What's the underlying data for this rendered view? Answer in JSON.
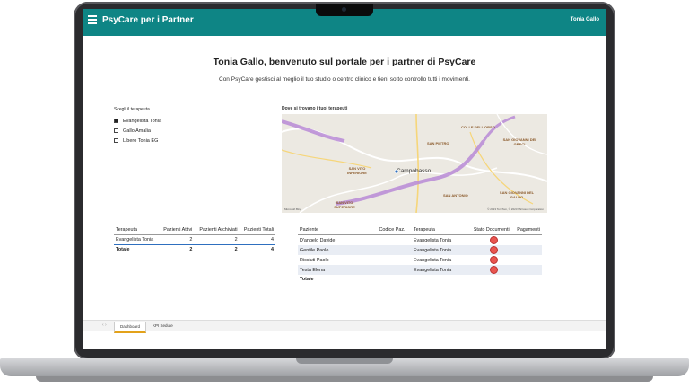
{
  "app": {
    "title": "PsyCare per i Partner",
    "user": "Tonia Gallo"
  },
  "welcome": {
    "heading": "Tonia Gallo, benvenuto sul portale per i partner di PsyCare",
    "subtitle": "Con PsyCare gestisci al meglio il tuo studio o centro clinico e tieni sotto controllo tutti i movimenti."
  },
  "slicer": {
    "title": "Scegli il terapeuta",
    "items": [
      {
        "label": "Evangelista Tonia",
        "checked": true
      },
      {
        "label": "Gallo Amalia",
        "checked": false
      },
      {
        "label": "Libero Tonia EG",
        "checked": false
      }
    ]
  },
  "map": {
    "title": "Dove si trovano i tuoi terapeuti",
    "city": "Campobasso",
    "labels": [
      "COLLE DELL'ORSO",
      "SAN PIETRO",
      "SAN GIOVANNI DEI GRECI",
      "SAN VITO INFERIORE",
      "SAN VITO SUPERIORE",
      "SAN GIOVANNI DEL GALDO",
      "SAN ANTONIO"
    ],
    "attribution": "© 2023 TomTom, © 2023 Microsoft Corporation",
    "logo": "Microsoft Bing"
  },
  "summary_table": {
    "headers": [
      "Terapeuta",
      "Pazienti Attivi",
      "Pazienti Archiviati",
      "Pazienti Totali"
    ],
    "rows": [
      [
        "Evangelista Tonia",
        "2",
        "2",
        "4"
      ]
    ],
    "total": [
      "Totale",
      "2",
      "2",
      "4"
    ]
  },
  "patients_table": {
    "headers": [
      "Paziente",
      "Codice Paz.",
      "Terapeuta",
      "Stato Documenti",
      "Pagamenti"
    ],
    "rows": [
      [
        "D'angelo Davide",
        "",
        "Evangelista Tonia"
      ],
      [
        "Gentile Paolo",
        "",
        "Evangelista Tonia"
      ],
      [
        "Ricciuti Paolo",
        "",
        "Evangelista Tonia"
      ],
      [
        "Testa Elena",
        "",
        "Evangelista Tonia"
      ]
    ],
    "total": "Totale",
    "status_color": "#e8554f"
  },
  "tabs": [
    {
      "label": "Dashboard",
      "active": true
    },
    {
      "label": "KPI Sedute",
      "active": false
    }
  ],
  "colors": {
    "topbar": "#0e8585",
    "accent_tab": "#e3a21a"
  }
}
